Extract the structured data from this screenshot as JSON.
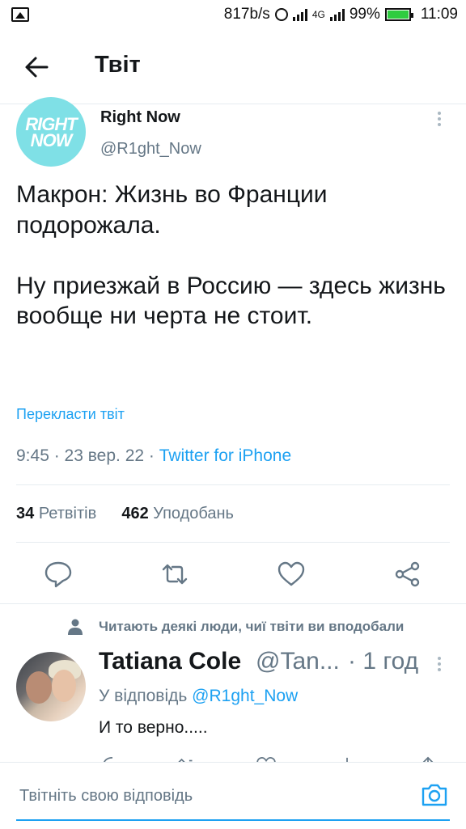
{
  "status_bar": {
    "speed": "817b/s",
    "network": "4G",
    "battery": "99%",
    "battery_level": 0.99,
    "time": "11:09"
  },
  "header": {
    "title": "Твіт",
    "back_icon": "arrow-left-icon"
  },
  "tweet": {
    "author_name": "Right Now",
    "author_handle": "@R1ght_Now",
    "avatar_logo": "RIGHT NOW",
    "text": "Макрон: Жизнь во Франции подорожала.\n\nНу приезжай в Россию — здесь жизнь вообще ни черта не стоит.",
    "translate_link": "Перекласти твіт",
    "time": "9:45",
    "date": "23 вер. 22",
    "source": "Twitter for iPhone",
    "retweets_count": "34",
    "retweets_label": "Ретвітів",
    "likes_count": "462",
    "likes_label": "Уподобань",
    "actions": [
      "reply-icon",
      "retweet-icon",
      "like-icon",
      "share-icon"
    ]
  },
  "social_context": {
    "text": "Читають деякі люди, чиї твіти ви вподобали",
    "icon": "person-icon"
  },
  "reply": {
    "author_name": "Tatiana Cole",
    "author_handle": "@Tan...",
    "time": "· 1 год",
    "reply_to_label": "У відповідь",
    "reply_to_handle": "@R1ght_Now",
    "text": "И то верно....."
  },
  "compose": {
    "placeholder": "Твітніть свою відповідь",
    "camera_icon": "camera-icon"
  },
  "colors": {
    "accent": "#1da1f2",
    "secondary_text": "#657786",
    "divider": "#e6ecf0"
  }
}
